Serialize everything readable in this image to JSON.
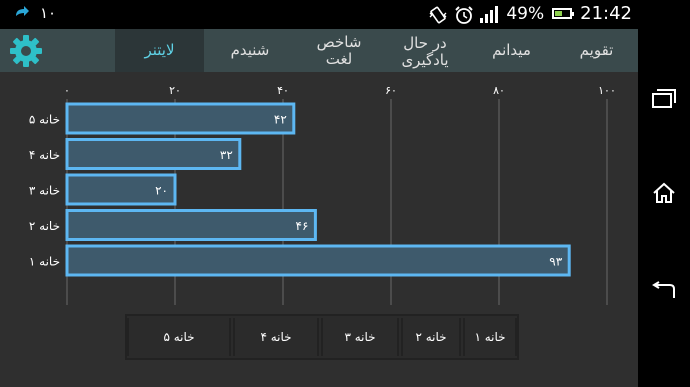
{
  "status_bar": {
    "left_icon": "share-icon",
    "left_text": "۱۰",
    "battery_percent_text": "49%",
    "battery_level": 0.49,
    "time": "21:42",
    "icons": [
      "vibrate-icon",
      "alarm-clock-icon",
      "signal-h-icon",
      "battery-icon"
    ]
  },
  "tabs": [
    {
      "label": "تقویم",
      "active": false
    },
    {
      "label": "میدانم",
      "active": false
    },
    {
      "label": "در حال یادگیری",
      "active": false
    },
    {
      "label": "شاخص لغت",
      "active": false
    },
    {
      "label": "شنیدم",
      "active": false
    },
    {
      "label": "لایتنر",
      "active": true
    }
  ],
  "settings_icon": "gear-icon",
  "chart_data": {
    "type": "bar",
    "orientation": "horizontal",
    "categories": [
      "خانه ۵",
      "خانه ۴",
      "خانه ۳",
      "خانه ۲",
      "خانه ۱"
    ],
    "values": [
      42,
      32,
      20,
      46,
      93
    ],
    "value_labels": [
      "۴۲",
      "۳۲",
      "۲۰",
      "۴۶",
      "۹۳"
    ],
    "x_ticks": [
      0,
      20,
      40,
      60,
      80,
      100
    ],
    "x_tick_labels": [
      "۰",
      "۲۰",
      "۴۰",
      "۶۰",
      "۸۰",
      "۱۰۰"
    ],
    "xlim": [
      0,
      100
    ],
    "grid": true,
    "bar_color": "#3e5a6c",
    "bar_border_color": "#5db7f2"
  },
  "legend": {
    "items": [
      "خانه ۵",
      "خانه ۴",
      "خانه ۳",
      "خانه ۲",
      "خانه ۱"
    ]
  },
  "nav": {
    "buttons": [
      "recent-apps-icon",
      "home-icon",
      "back-icon"
    ]
  }
}
